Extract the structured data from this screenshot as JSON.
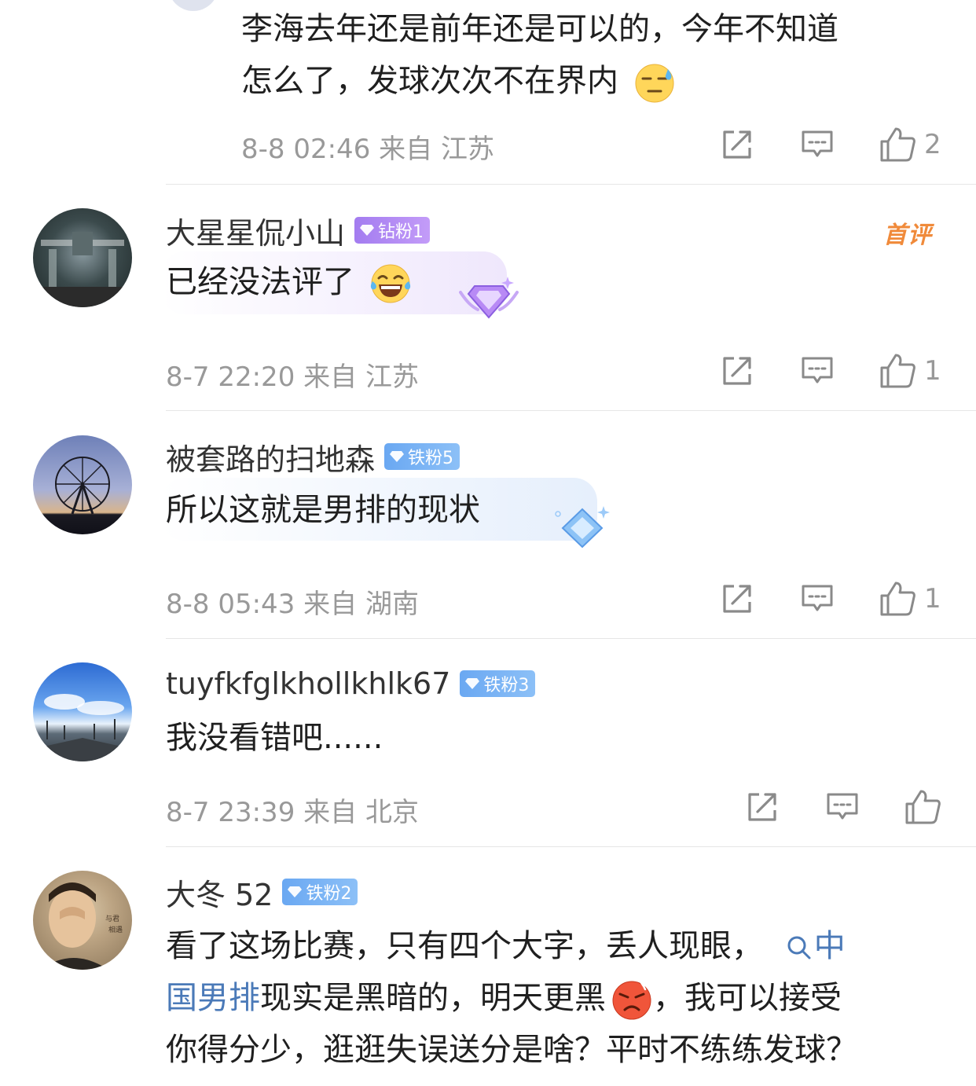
{
  "comments": [
    {
      "text_lines": [
        "李海去年还是前年还是可以的，今年不知道",
        "怎么了，发球次次不在界内"
      ],
      "emoji": "sweat-emoji",
      "time": "8-8 02:46",
      "from_label": "来自",
      "location": "江苏",
      "likes": "2"
    },
    {
      "name": "大星星侃小山",
      "badge": "钻粉1",
      "first_tag": "首评",
      "text": "已经没法评了",
      "emoji": "laugh-cry-emoji",
      "time": "8-7 22:20",
      "from_label": "来自",
      "location": "江苏",
      "likes": "1"
    },
    {
      "name": "被套路的扫地森",
      "badge": "铁粉5",
      "text": "所以这就是男排的现状",
      "time": "8-8 05:43",
      "from_label": "来自",
      "location": "湖南",
      "likes": "1"
    },
    {
      "name": "tuyfkfglkhollkhlk67",
      "badge": "铁粉3",
      "text": "我没看错吧......",
      "time": "8-7 23:39",
      "from_label": "来自",
      "location": "北京",
      "likes": ""
    },
    {
      "name": "大冬 52",
      "badge": "铁粉2",
      "line1_prefix": "看了这场比赛，只有四个大字，丢人现眼，",
      "topic_part1": "中",
      "topic_part2": "国男排",
      "line2_suffix": "现实是黑暗的，明天更黑",
      "emoji": "angry-emoji",
      "line2_after_emoji": "，我可以接受",
      "line3": "你得分少，逛逛失误送分是啥？平时不练练发球？"
    }
  ],
  "colors": {
    "topic_link": "#4b7ab8",
    "meta_gray": "#999999",
    "first_tag_orange": "#f08a3a",
    "badge_purple": "#a37cf0",
    "badge_blue": "#6aa8f2"
  }
}
